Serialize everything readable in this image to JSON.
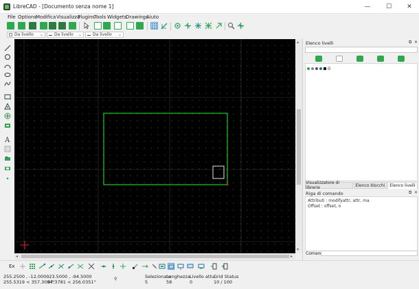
{
  "window": {
    "title": "LibreCAD - [Documento senza nome 1]",
    "minimize_glyph": "—",
    "maximize_glyph": "☐",
    "close_glyph": "✕"
  },
  "menu": [
    "File",
    "Options",
    "Modifica",
    "Visualizza",
    "Plugins",
    "Tools",
    "Widgets",
    "Drawings",
    "Aiuto"
  ],
  "layer_dropdowns": [
    {
      "label": "Da livello"
    },
    {
      "label": "Da livello"
    },
    {
      "label": "Da livello"
    }
  ],
  "dock": {
    "layer_panel": {
      "title": "Elenco livelli",
      "layers": [
        {
          "name": "0"
        }
      ]
    },
    "tabs": [
      {
        "label": "Visualizzatore di librerie"
      },
      {
        "label": "Elenco blocchi"
      },
      {
        "label": "Elenco livelli",
        "active": true
      }
    ],
    "command": {
      "title": "Riga di comando",
      "lines": [
        "Attributi : modifyattr, attr, ma",
        "Offset : offset, o"
      ],
      "prompt_label": "Comando:",
      "value": ""
    }
  },
  "snap": {
    "label": "Ex"
  },
  "status": {
    "coords_line1": "255.2500 , -12.0000",
    "coords_line2": "255.5319 < 357.3084°",
    "rel_line1": "-23.5000 , -94.5000",
    "rel_line2": "97.3781 < 256.0351°",
    "selected_label": "Selezionato",
    "selected_value": "5",
    "length_label": "Lunghezza",
    "length_value": "58",
    "layer_label": "Livello attu.",
    "layer_value": "0",
    "grid_label": "Grid Status",
    "grid_value": "10 / 100"
  },
  "colors": {
    "canvas": "#000000",
    "rect": "#22c922",
    "selection_box": "#e6e6e6",
    "origin": "#e02020",
    "toolbar_green": "#2fa84f"
  }
}
